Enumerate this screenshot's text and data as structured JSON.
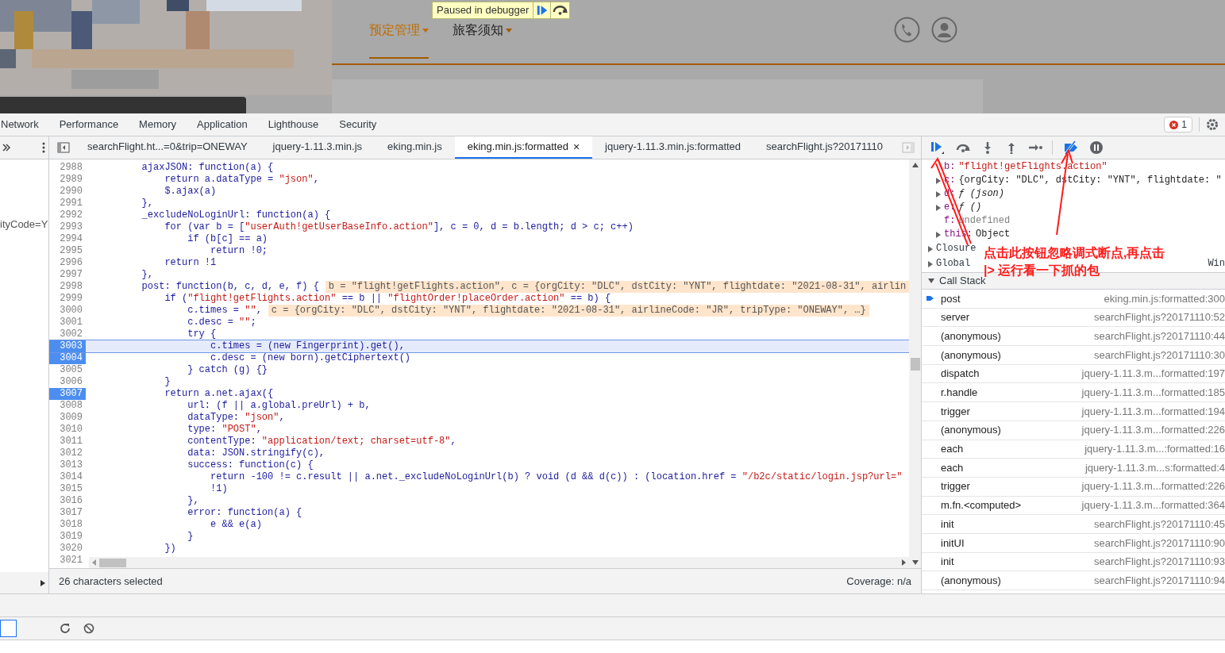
{
  "page": {
    "paused_badge": "Paused in debugger",
    "nav": [
      {
        "label": "预定管理",
        "selected": true
      },
      {
        "label": "旅客须知",
        "selected": false
      }
    ]
  },
  "panel_tabs": [
    "Network",
    "Performance",
    "Memory",
    "Application",
    "Lighthouse",
    "Security"
  ],
  "error_count": "1",
  "file_tabs": [
    {
      "label": "searchFlight.ht...=0&trip=ONEWAY",
      "selected": false
    },
    {
      "label": "jquery-1.11.3.min.js",
      "selected": false
    },
    {
      "label": "eking.min.js",
      "selected": false
    },
    {
      "label": "eking.min.js:formatted",
      "selected": true,
      "close": "×"
    },
    {
      "label": "jquery-1.11.3.min.js:formatted",
      "selected": false
    },
    {
      "label": "searchFlight.js?20171110",
      "selected": false
    }
  ],
  "navigator_text": "ityCode=Y",
  "code_lines": [
    {
      "number": "2988",
      "code": "        ajaxJSON: function(a) {"
    },
    {
      "number": "2989",
      "code": "            return a.dataType = \"json\","
    },
    {
      "number": "2990",
      "code": "            $.ajax(a)"
    },
    {
      "number": "2991",
      "code": "        },"
    },
    {
      "number": "2992",
      "code": "        _excludeNoLoginUrl: function(a) {"
    },
    {
      "number": "2993",
      "code": "            for (var b = [\"userAuth!getUserBaseInfo.action\"], c = 0, d = b.length; d > c; c++)"
    },
    {
      "number": "2994",
      "code": "                if (b[c] == a)"
    },
    {
      "number": "2995",
      "code": "                    return !0;"
    },
    {
      "number": "2996",
      "code": "            return !1"
    },
    {
      "number": "2997",
      "code": "        },"
    },
    {
      "number": "2998",
      "code": "        post: function(b, c, d, e, f) {",
      "inline_value": "b = \"flight!getFlights.action\", c = {orgCity: \"DLC\", dstCity: \"YNT\", flightdate: \"2021-08-31\", airlin"
    },
    {
      "number": "2999",
      "code": "            if (\"flight!getFlights.action\" == b || \"flightOrder!placeOrder.action\" == b) {"
    },
    {
      "number": "3000",
      "code": "                c.times = \"\",",
      "inline_value": "c = {orgCity: \"DLC\", dstCity: \"YNT\", flightdate: \"2021-08-31\", airlineCode: \"JR\", tripType: \"ONEWAY\", …}"
    },
    {
      "number": "3001",
      "code": "                c.desc = \"\";"
    },
    {
      "number": "3002",
      "code": "                try {"
    },
    {
      "number": "3003",
      "code": "                    c.times = (new Fingerprint).get(),",
      "breakpoint": true,
      "current": true
    },
    {
      "number": "3004",
      "code": "                    c.desc = (new born).getCiphertext()",
      "breakpoint": true
    },
    {
      "number": "3005",
      "code": "                } catch (g) {}"
    },
    {
      "number": "3006",
      "code": "            }"
    },
    {
      "number": "3007",
      "code": "            return a.net.ajax({",
      "breakpoint": true
    },
    {
      "number": "3008",
      "code": "                url: (f || a.global.preUrl) + b,"
    },
    {
      "number": "3009",
      "code": "                dataType: \"json\","
    },
    {
      "number": "3010",
      "code": "                type: \"POST\","
    },
    {
      "number": "3011",
      "code": "                contentType: \"application/text; charset=utf-8\","
    },
    {
      "number": "3012",
      "code": "                data: JSON.stringify(c),"
    },
    {
      "number": "3013",
      "code": "                success: function(c) {"
    },
    {
      "number": "3014",
      "code": "                    return -100 != c.result || a.net._excludeNoLoginUrl(b) ? void (d && d(c)) : (location.href = \"/b2c/static/login.jsp?url=\""
    },
    {
      "number": "3015",
      "code": "                    !1)"
    },
    {
      "number": "3016",
      "code": "                },"
    },
    {
      "number": "3017",
      "code": "                error: function(a) {"
    },
    {
      "number": "3018",
      "code": "                    e && e(a)"
    },
    {
      "number": "3019",
      "code": "                }"
    },
    {
      "number": "3020",
      "code": "            })"
    },
    {
      "number": "3021"
    }
  ],
  "status": {
    "selection": "26 characters selected",
    "coverage": "Coverage: n/a"
  },
  "scope": [
    {
      "name": "b:",
      "value": "\"flight!getFlights.action\"",
      "kind": "string",
      "expandable": false
    },
    {
      "name": "c:",
      "value": "{orgCity: \"DLC\", dstCity: \"YNT\", flightdate: \"",
      "kind": "object",
      "expandable": true
    },
    {
      "name": "d:",
      "value": "ƒ (json)",
      "kind": "function",
      "expandable": true
    },
    {
      "name": "e:",
      "value": "ƒ ()",
      "kind": "function",
      "expandable": true
    },
    {
      "name": "f:",
      "value": "undefined",
      "kind": "undefined",
      "expandable": false
    },
    {
      "name": "this:",
      "value": "Object",
      "kind": "object",
      "expandable": true
    }
  ],
  "scope_groups": [
    {
      "label": "Closure"
    },
    {
      "label": "Global",
      "value": "Win"
    }
  ],
  "annotation": [
    "点击此按钮忽略调式断点,再点击",
    "|> 运行看一下抓的包"
  ],
  "call_stack": {
    "title": "Call Stack",
    "expanded": true,
    "frames": [
      {
        "name": "post",
        "location": "eking.min.js:formatted:300",
        "current": true
      },
      {
        "name": "server",
        "location": "searchFlight.js?20171110:52",
        "current": false
      },
      {
        "name": "(anonymous)",
        "location": "searchFlight.js?20171110:44",
        "current": false
      },
      {
        "name": "(anonymous)",
        "location": "searchFlight.js?20171110:30",
        "current": false
      },
      {
        "name": "dispatch",
        "location": "jquery-1.11.3.m...formatted:197",
        "current": false
      },
      {
        "name": "r.handle",
        "location": "jquery-1.11.3.m...formatted:185",
        "current": false
      },
      {
        "name": "trigger",
        "location": "jquery-1.11.3.m...formatted:194",
        "current": false
      },
      {
        "name": "(anonymous)",
        "location": "jquery-1.11.3.m...formatted:226",
        "current": false
      },
      {
        "name": "each",
        "location": "jquery-1.11.3.m...:formatted:16",
        "current": false
      },
      {
        "name": "each",
        "location": "jquery-1.11.3.m...s:formatted:4",
        "current": false
      },
      {
        "name": "trigger",
        "location": "jquery-1.11.3.m...formatted:226",
        "current": false
      },
      {
        "name": "m.fn.<computed>",
        "location": "jquery-1.11.3.m...formatted:364",
        "current": false
      },
      {
        "name": "init",
        "location": "searchFlight.js?20171110:45",
        "current": false
      },
      {
        "name": "initUI",
        "location": "searchFlight.js?20171110:90",
        "current": false
      },
      {
        "name": "init",
        "location": "searchFlight.js?20171110:93",
        "current": false
      },
      {
        "name": "(anonymous)",
        "location": "searchFlight.js?20171110:94",
        "current": false
      }
    ]
  }
}
